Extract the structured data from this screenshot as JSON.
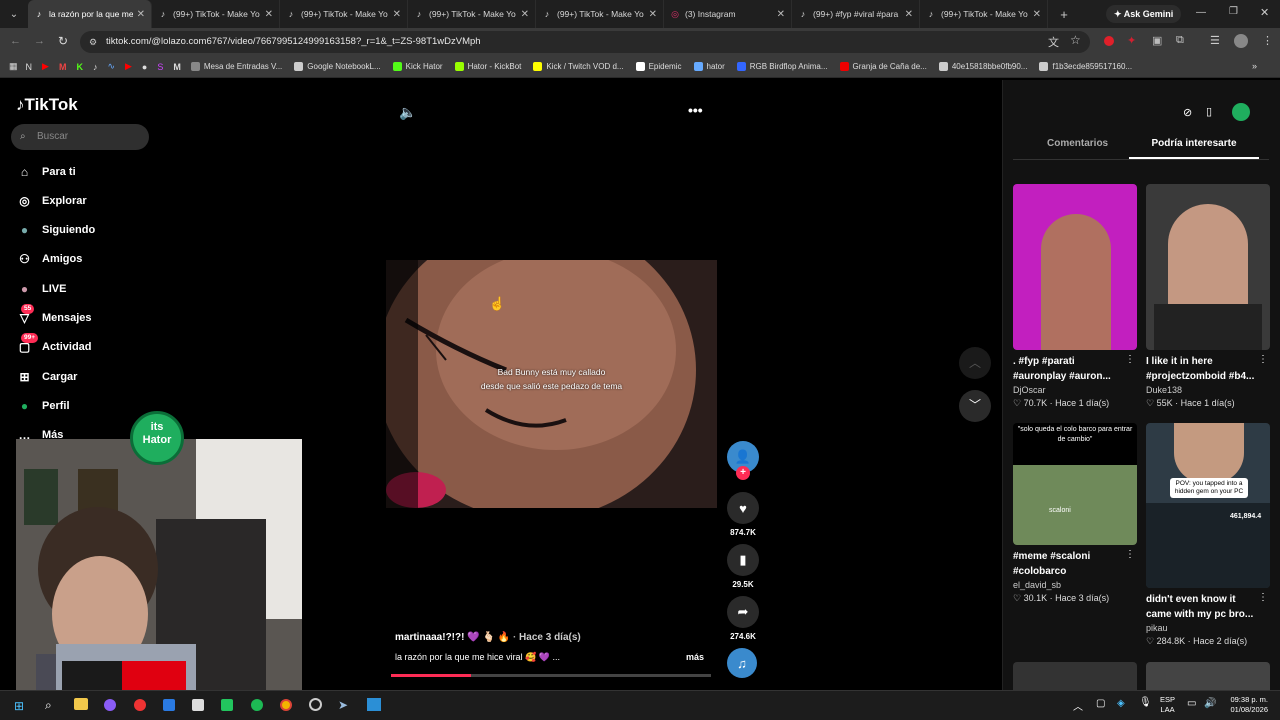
{
  "browser": {
    "tabs": [
      {
        "title": "la razón por la que me",
        "active": true,
        "icon": "tiktok-icon"
      },
      {
        "title": "(99+) TikTok - Make Yo",
        "active": false,
        "icon": "tiktok-icon"
      },
      {
        "title": "(99+) TikTok - Make Yo",
        "active": false,
        "icon": "tiktok-icon"
      },
      {
        "title": "(99+) TikTok - Make Yo",
        "active": false,
        "icon": "tiktok-icon"
      },
      {
        "title": "(99+) TikTok - Make Yo",
        "active": false,
        "icon": "tiktok-icon"
      },
      {
        "title": "(3) Instagram",
        "active": false,
        "icon": "instagram-icon"
      },
      {
        "title": "(99+) #fyp #viral #para",
        "active": false,
        "icon": "tiktok-icon"
      },
      {
        "title": "(99+) TikTok - Make Yo",
        "active": false,
        "icon": "tiktok-icon"
      }
    ],
    "ask_gemini": "Ask Gemini",
    "url": "tiktok.com/@lolazo.com6767/video/7667995124999163158?_r=1&_t=ZS-98T1wDzVMph",
    "bookmarks": [
      "Mesa de Entradas V...",
      "Google NotebookL...",
      "Kick Hator",
      "Hator - KickBot",
      "Kick / Twitch VOD d...",
      "Epidemic",
      "hator",
      "RGB Birdflop Anima...",
      "Granja de Caña de...",
      "40e15818bbe0fb90...",
      "f1b3ecde859517160..."
    ]
  },
  "sidebar": {
    "logo": "TikTok",
    "search_placeholder": "Buscar",
    "items": [
      {
        "label": "Para ti",
        "icon": "home-icon"
      },
      {
        "label": "Explorar",
        "icon": "compass-icon"
      },
      {
        "label": "Siguiendo",
        "icon": "following-avatar-icon"
      },
      {
        "label": "Amigos",
        "icon": "friends-icon"
      },
      {
        "label": "LIVE",
        "icon": "live-avatar-icon"
      },
      {
        "label": "Mensajes",
        "icon": "messages-icon",
        "badge": "55"
      },
      {
        "label": "Actividad",
        "icon": "activity-icon",
        "badge": "99+"
      },
      {
        "label": "Cargar",
        "icon": "upload-icon"
      },
      {
        "label": "Perfil",
        "icon": "profile-avatar-icon"
      },
      {
        "label": "Más",
        "icon": "more-icon"
      }
    ]
  },
  "overlay": {
    "webcam_logo_line1": "its",
    "webcam_logo_line2": "Hator"
  },
  "video": {
    "caption_line1": "Bad Bunny está muy callado",
    "caption_line2": "desde que salió este pedazo de tema",
    "author": "martinaaa!?!?! 💜 🫰🏻 🔥",
    "age": "Hace 3 día(s)",
    "description": "la razón por la que me hice viral 🥰 💜 ...",
    "more": "más",
    "progress": 0.25,
    "likes": "874.7K",
    "saves": "29.5K",
    "shares": "274.6K"
  },
  "right_panel": {
    "tabs": [
      "Comentarios",
      "Podría interesarte"
    ],
    "active_tab": 1,
    "cards": [
      {
        "title": ". #fyp #parati\n#auronplay #auron...",
        "author": "DjOscar",
        "likes": "70.7K",
        "age": "Hace 1 día(s)",
        "thumb_color": "#c21fbf",
        "overlay": ""
      },
      {
        "title": "I like it in here\n#projectzomboid #b4...",
        "author": "Duke138",
        "likes": "55K",
        "age": "Hace 1 día(s)",
        "thumb_color": "#3a3a3a",
        "overlay": ""
      },
      {
        "title": "#meme #scaloni\n#colobarco",
        "author": "el_david_sb",
        "likes": "30.1K",
        "age": "Hace 3 día(s)",
        "thumb_color": "#000000",
        "overlay": "\"solo queda el colo barco para entrar de cambio\"",
        "inner": "scaloni"
      },
      {
        "title": "didn't even know it\ncame with my pc bro...",
        "author": "pikau",
        "likes": "284.8K",
        "age": "Hace 2 día(s)",
        "thumb_color": "#2e3b45",
        "overlay": "POV: you tapped into a hidden gem on your PC",
        "inner": "461,894.4"
      }
    ]
  },
  "taskbar": {
    "lang": "ESP",
    "lang2": "LAA",
    "time": "09:38 p. m.",
    "date": "01/08/2026"
  }
}
